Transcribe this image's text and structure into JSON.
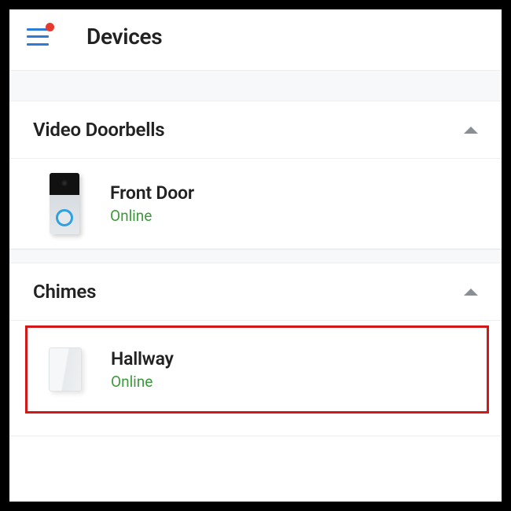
{
  "header": {
    "title": "Devices"
  },
  "sections": [
    {
      "title": "Video Doorbells",
      "devices": [
        {
          "name": "Front Door",
          "status": "Online"
        }
      ]
    },
    {
      "title": "Chimes",
      "devices": [
        {
          "name": "Hallway",
          "status": "Online"
        }
      ]
    }
  ],
  "colors": {
    "accent": "#2c7bd4",
    "status_online": "#3c9a3c",
    "highlight": "#d11919"
  }
}
